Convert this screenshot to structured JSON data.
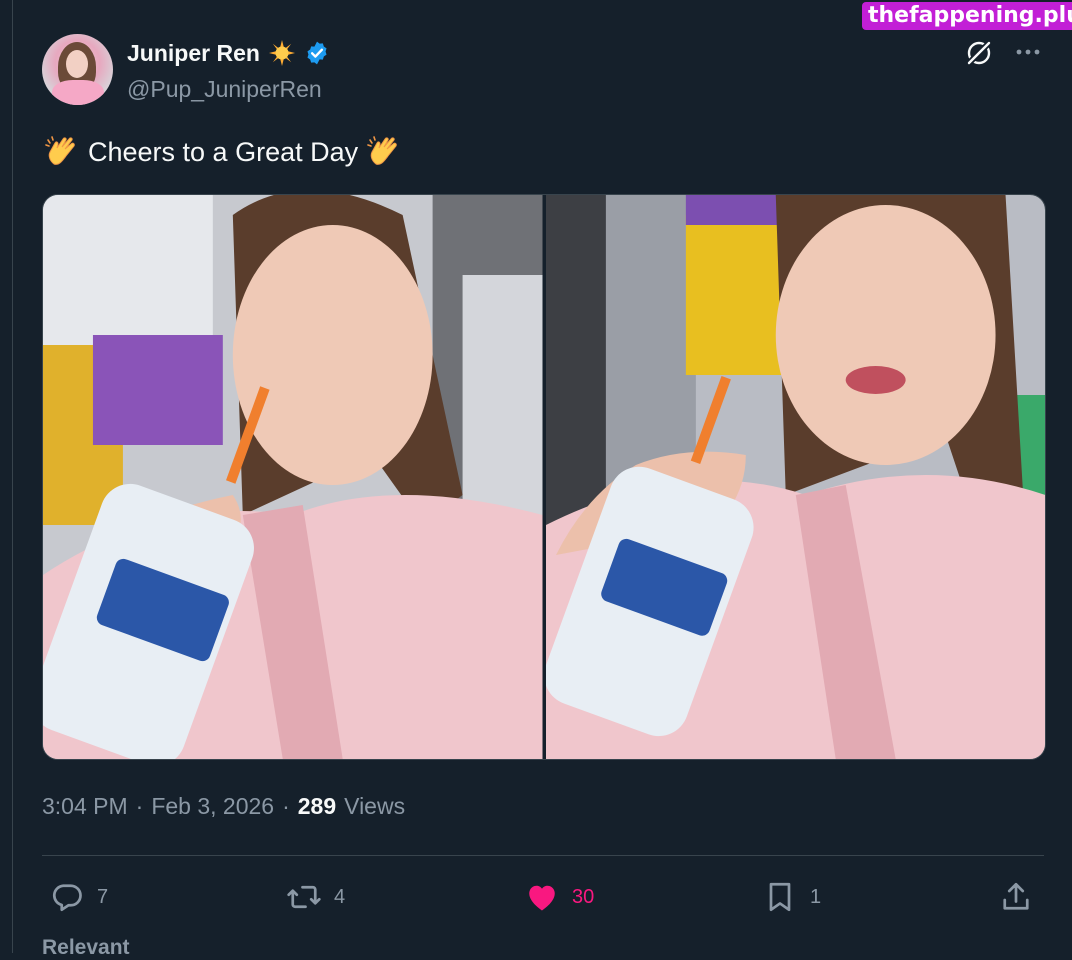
{
  "watermark": "thefappening.plus",
  "author": {
    "display_name": "Juniper Ren",
    "handle": "@Pup_JuniperRen",
    "name_emoji": "sun-emoji",
    "verified_badge": "verified-badge-icon"
  },
  "header_actions": {
    "grok_icon": "grok-icon",
    "more_icon": "more-icon"
  },
  "tweet": {
    "text": "Cheers to a Great Day",
    "leading_emoji": "clapping-hands-emoji",
    "trailing_emoji": "clapping-hands-emoji",
    "media": [
      {
        "alt": "photo-1"
      },
      {
        "alt": "photo-2"
      }
    ]
  },
  "meta": {
    "time": "3:04 PM",
    "sep1": "·",
    "date": "Feb 3, 2026",
    "sep2": "·",
    "views_count": "289",
    "views_label": "Views"
  },
  "actions": {
    "replies": "7",
    "reposts": "4",
    "likes": "30",
    "bookmarks": "1"
  },
  "footer": {
    "relevant_label": "Relevant"
  },
  "colors": {
    "background": "#15202b",
    "text_primary": "#f7f9f9",
    "text_secondary": "#8b98a5",
    "like_pink": "#f91880",
    "verified_blue": "#1d9bf0",
    "watermark_bg": "#c21fd6"
  }
}
